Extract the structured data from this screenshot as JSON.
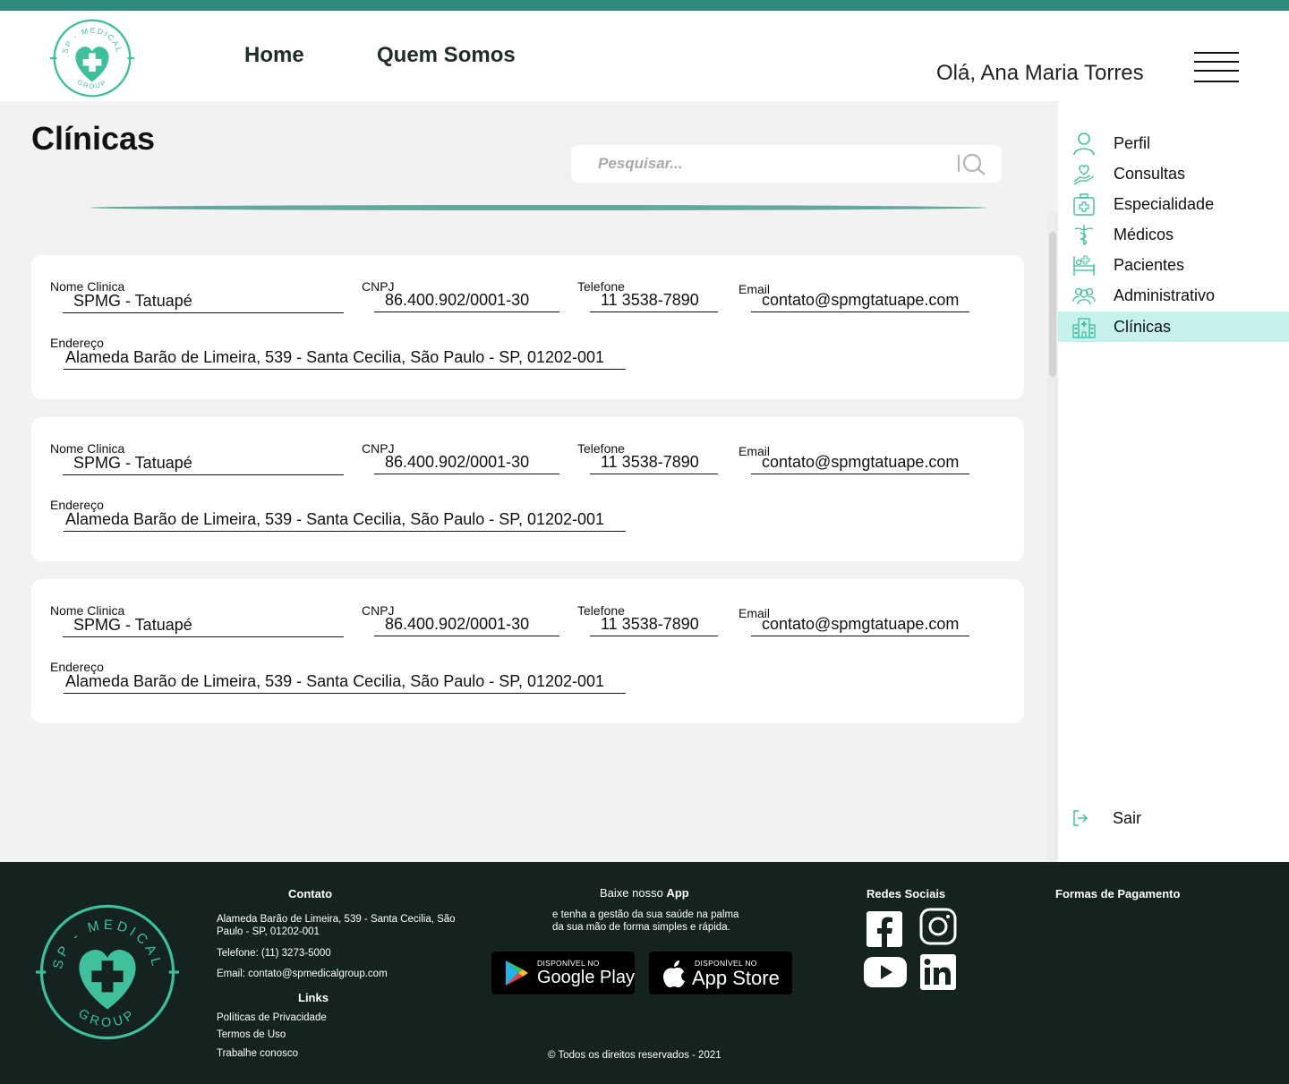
{
  "header": {
    "logo_top": "SP - MEDICAL",
    "logo_bottom": "GROUP",
    "nav": [
      "Home",
      "Quem Somos"
    ],
    "greeting": "Olá, Ana Maria Torres"
  },
  "main": {
    "title": "Clínicas",
    "search": {
      "placeholder": "Pesquisar..."
    },
    "labels": {
      "nome": "Nome Clinica",
      "cnpj": "CNPJ",
      "telefone": "Telefone",
      "email": "Email",
      "endereco": "Endereço"
    },
    "clinics": [
      {
        "nome": "SPMG - Tatuapé",
        "cnpj": "86.400.902/0001-30",
        "telefone": "11 3538-7890",
        "email": "contato@spmgtatuape.com",
        "endereco": "Alameda Barão de Limeira, 539 - Santa Cecilia, São Paulo - SP, 01202-001"
      },
      {
        "nome": "SPMG - Tatuapé",
        "cnpj": "86.400.902/0001-30",
        "telefone": "11 3538-7890",
        "email": "contato@spmgtatuape.com",
        "endereco": "Alameda Barão de Limeira, 539 - Santa Cecilia, São Paulo - SP, 01202-001"
      },
      {
        "nome": "SPMG - Tatuapé",
        "cnpj": "86.400.902/0001-30",
        "telefone": "11 3538-7890",
        "email": "contato@spmgtatuape.com",
        "endereco": "Alameda Barão de Limeira, 539 - Santa Cecilia, São Paulo - SP, 01202-001"
      }
    ]
  },
  "sidebar": {
    "items": [
      {
        "label": "Perfil",
        "icon": "user-icon"
      },
      {
        "label": "Consultas",
        "icon": "heart-hand-icon"
      },
      {
        "label": "Especialidade",
        "icon": "medical-kit-icon"
      },
      {
        "label": "Médicos",
        "icon": "caduceus-icon"
      },
      {
        "label": "Pacientes",
        "icon": "hospital-bed-icon"
      },
      {
        "label": "Administrativo",
        "icon": "group-icon"
      },
      {
        "label": "Clínicas",
        "icon": "hospital-building-icon",
        "active": true
      }
    ],
    "logout": "Sair"
  },
  "footer": {
    "contato": {
      "heading": "Contato",
      "address": "Alameda Barão de Limeira, 539 - Santa Cecilia, São Paulo - SP, 01202-001",
      "phone": "Telefone: (11) 3273-5000",
      "email": "Email: contato@spmedicalgroup.com"
    },
    "links": {
      "heading": "Links",
      "items": [
        "Políticas de Privacidade",
        "Termos de Uso",
        "Trabalhe conosco"
      ]
    },
    "app": {
      "heading_pre": "Baixe nosso",
      "heading_bold": "App",
      "line1": "e tenha a gestão da sua saúde na palma",
      "line2": "da sua mão de forma simples e rápida.",
      "google_small": "DISPONÍVEL NO",
      "google_big": "Google Play",
      "apple_small": "DISPONÍVEL NO",
      "apple_big": "App Store"
    },
    "social": {
      "heading": "Redes Sociais"
    },
    "payment": {
      "heading": "Formas de Pagamento"
    },
    "copyright": "© Todos os direitos reservados - 2021"
  },
  "colors": {
    "accent": "#2e8b7e",
    "logo": "#3fbf9b",
    "active_item": "#c6f1ec",
    "footer_bg": "#14231f"
  }
}
